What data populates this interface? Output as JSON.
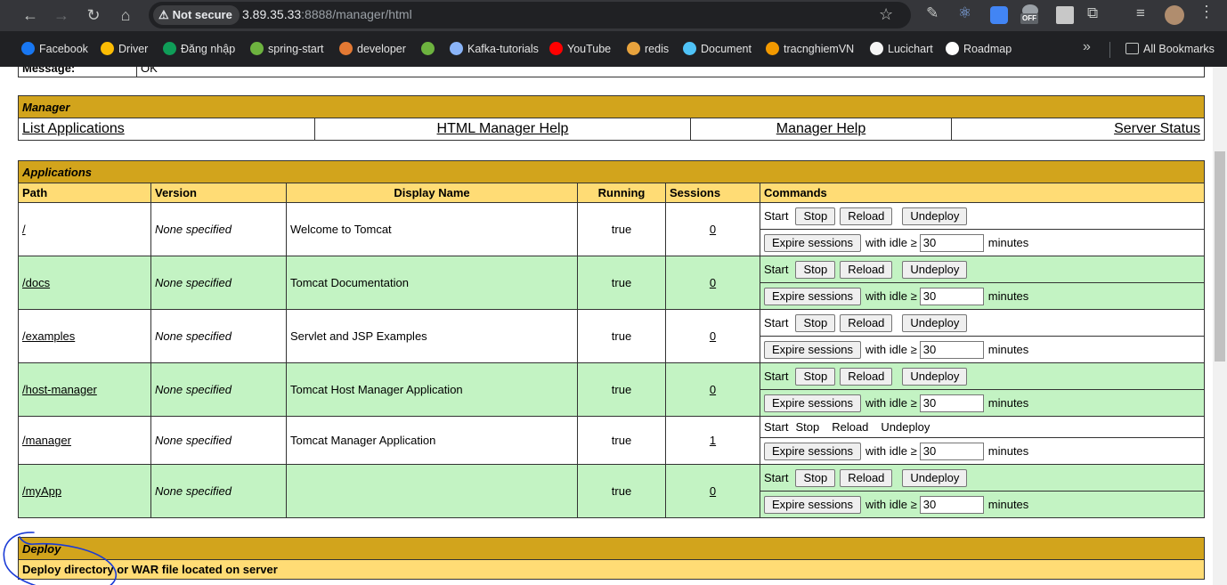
{
  "browser": {
    "security_label": "Not secure",
    "url_host": "3.89.35.33",
    "url_rest": ":8888/manager/html",
    "ext_badge": "OFF",
    "bookmarks": [
      {
        "label": "Facebook",
        "icon": "facebook-icon",
        "color": "#1877f2"
      },
      {
        "label": "Driver",
        "icon": "drive-icon",
        "color": "#fbbc04"
      },
      {
        "label": "Đăng nhập",
        "icon": "globe-icon",
        "color": "#0f9d58"
      },
      {
        "label": "spring-start",
        "icon": "spring-icon",
        "color": "#6db33f"
      },
      {
        "label": "developer",
        "icon": "developer-icon",
        "color": "#e37933"
      },
      {
        "label": "",
        "icon": "power-icon",
        "color": "#6db33f"
      },
      {
        "label": "Kafka-tutorials",
        "icon": "kafka-icon",
        "color": "#8ab4f8"
      },
      {
        "label": "YouTube",
        "icon": "youtube-icon",
        "color": "#ff0000"
      },
      {
        "label": "redis",
        "icon": "redis-icon",
        "color": "#e8a33d"
      },
      {
        "label": "Document",
        "icon": "document-icon",
        "color": "#4fc3f7"
      },
      {
        "label": "tracnghiemVN",
        "icon": "quiz-icon",
        "color": "#f29900"
      },
      {
        "label": "Lucichart",
        "icon": "lucidchart-icon",
        "color": "#f5f5f5"
      },
      {
        "label": "Roadmap",
        "icon": "github-icon",
        "color": "#ffffff"
      }
    ],
    "all_bookmarks": "All Bookmarks"
  },
  "message": {
    "label": "Message:",
    "value": "OK"
  },
  "manager": {
    "title": "Manager",
    "links": [
      "List Applications",
      "HTML Manager Help",
      "Manager Help",
      "Server Status"
    ]
  },
  "applications": {
    "title": "Applications",
    "headers": [
      "Path",
      "Version",
      "Display Name",
      "Running",
      "Sessions",
      "Commands"
    ],
    "rows": [
      {
        "path": "/",
        "version": "None specified",
        "display": "Welcome to Tomcat",
        "running": "true",
        "sessions": "0",
        "buttons": true
      },
      {
        "path": "/docs",
        "version": "None specified",
        "display": "Tomcat Documentation",
        "running": "true",
        "sessions": "0",
        "buttons": true
      },
      {
        "path": "/examples",
        "version": "None specified",
        "display": "Servlet and JSP Examples",
        "running": "true",
        "sessions": "0",
        "buttons": true
      },
      {
        "path": "/host-manager",
        "version": "None specified",
        "display": "Tomcat Host Manager Application",
        "running": "true",
        "sessions": "0",
        "buttons": true
      },
      {
        "path": "/manager",
        "version": "None specified",
        "display": "Tomcat Manager Application",
        "running": "true",
        "sessions": "1",
        "buttons": false
      },
      {
        "path": "/myApp",
        "version": "None specified",
        "display": "",
        "running": "true",
        "sessions": "0",
        "buttons": true
      }
    ],
    "commands": {
      "start": "Start",
      "stop": "Stop",
      "reload": "Reload",
      "undeploy": "Undeploy",
      "expire": "Expire sessions",
      "with_idle": "with idle ≥",
      "idle_value": "30",
      "minutes": "minutes"
    }
  },
  "deploy": {
    "title": "Deploy",
    "subtitle": "Deploy directory or WAR file located on server"
  },
  "colors": {
    "title_bar": "#d2a41c",
    "header_bar": "#ffdc75",
    "row_green": "#c3f3c3",
    "annotation": "#1a3bd6"
  }
}
